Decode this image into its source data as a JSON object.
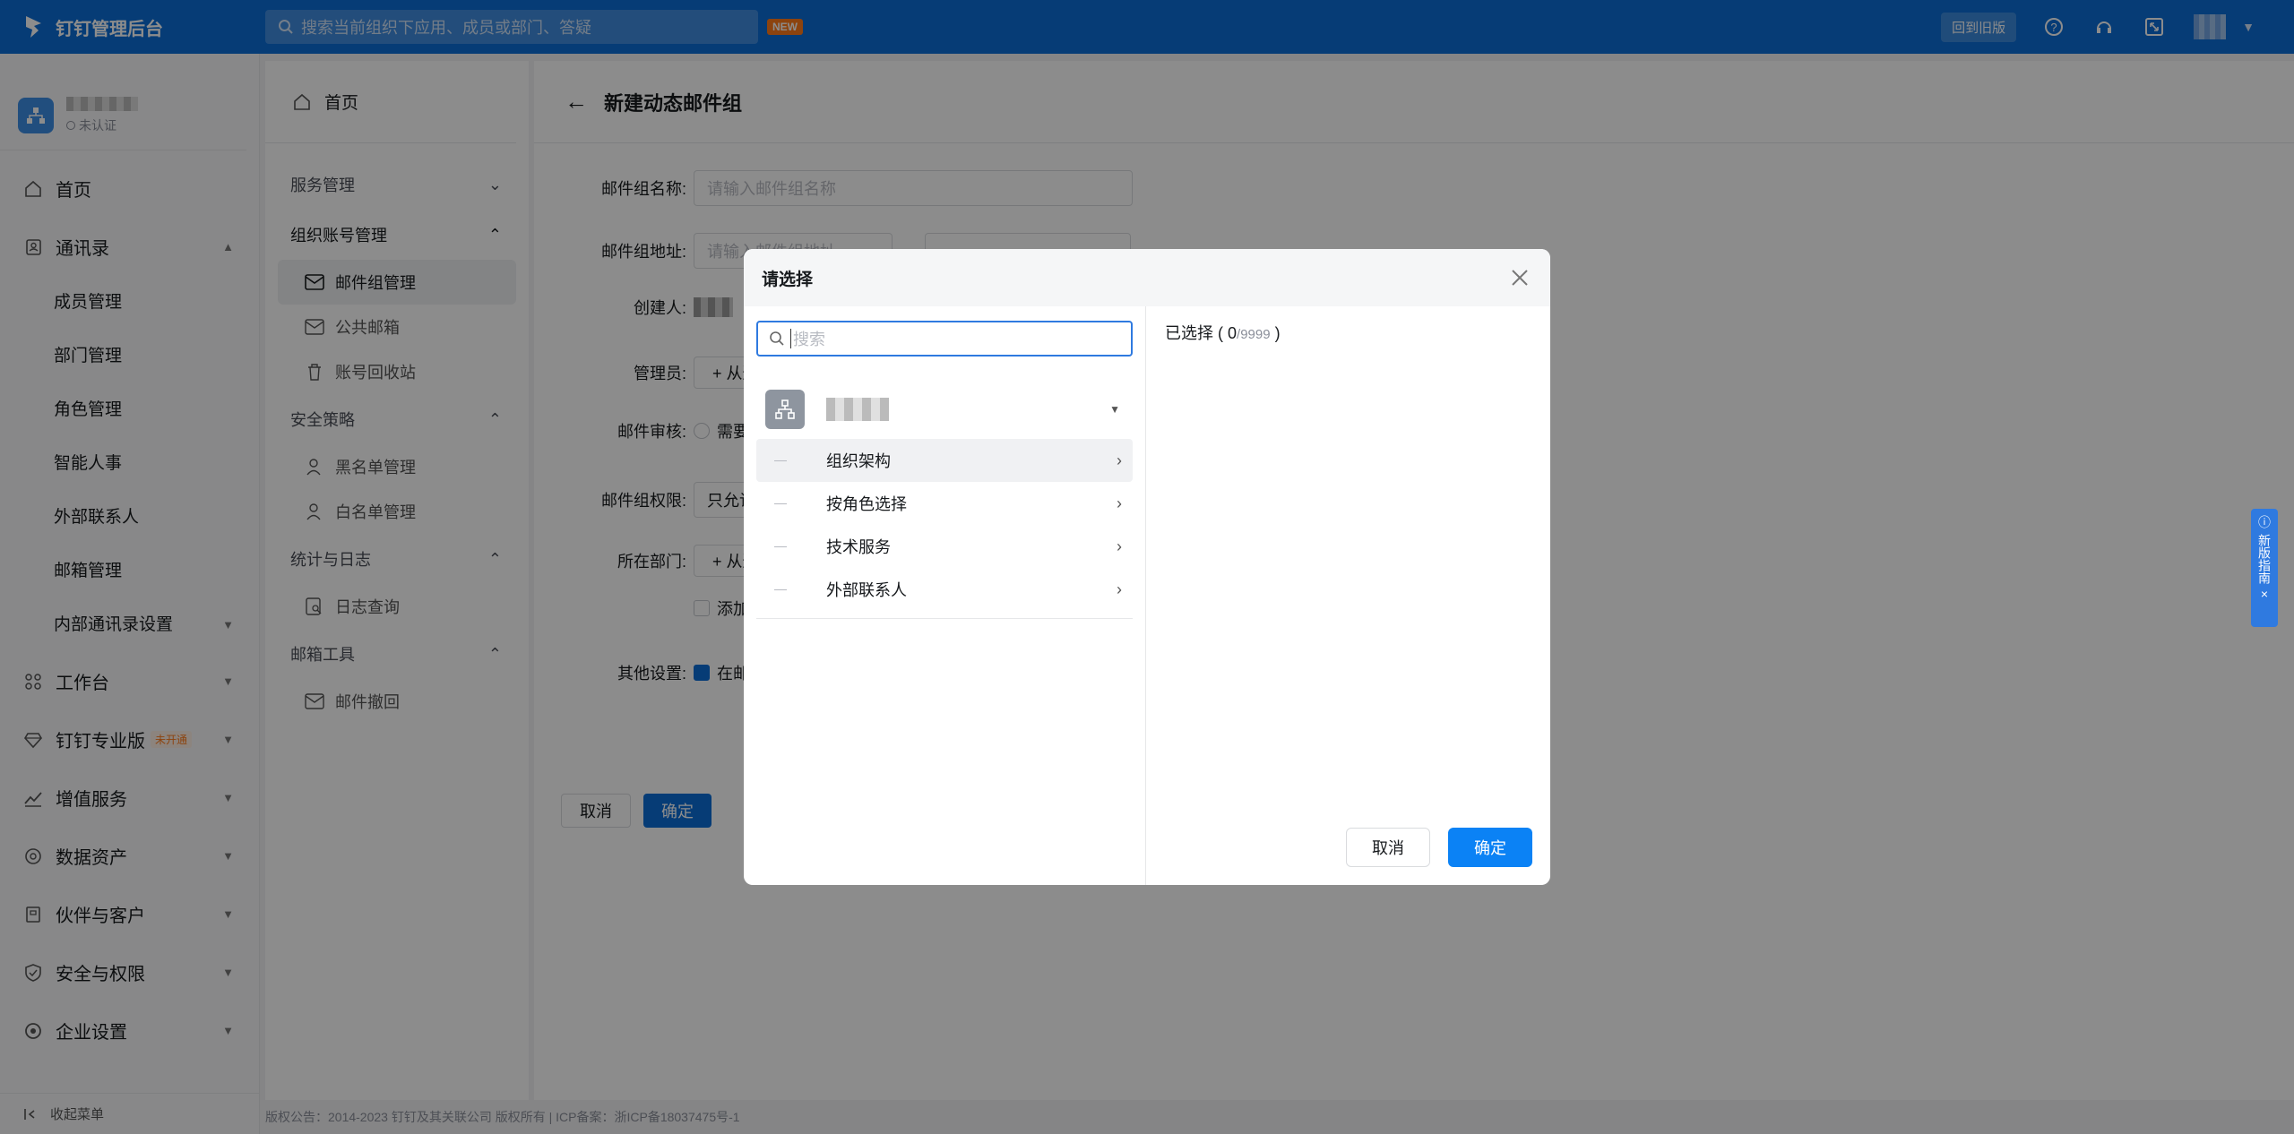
{
  "topbar": {
    "app_name": "钉钉管理后台",
    "search_placeholder": "搜索当前组织下应用、成员或部门、答疑",
    "new_badge": "NEW",
    "old_version": "回到旧版"
  },
  "org": {
    "status": "未认证"
  },
  "sidebar": {
    "home": "首页",
    "contacts": "通讯录",
    "contacts_items": [
      "成员管理",
      "部门管理",
      "角色管理",
      "智能人事",
      "外部联系人",
      "邮箱管理",
      "内部通讯录设置"
    ],
    "workbench": "工作台",
    "pro": "钉钉专业版",
    "pro_badge": "未开通",
    "value_added": "增值服务",
    "data_assets": "数据资产",
    "partners": "伙伴与客户",
    "security": "安全与权限",
    "enterprise": "企业设置",
    "collapse": "收起菜单"
  },
  "submenu": {
    "home": "首页",
    "service_mgmt": "服务管理",
    "org_account": "组织账号管理",
    "mail_group": "邮件组管理",
    "public_mail": "公共邮箱",
    "recycle": "账号回收站",
    "security_policy": "安全策略",
    "blacklist": "黑名单管理",
    "whitelist": "白名单管理",
    "stats_logs": "统计与日志",
    "log_query": "日志查询",
    "mail_tools": "邮箱工具",
    "mail_recall": "邮件撤回"
  },
  "main": {
    "title": "新建动态邮件组",
    "name_label": "邮件组名称:",
    "name_placeholder": "请输入邮件组名称",
    "addr_label": "邮件组地址:",
    "addr_placeholder": "请输入邮件组地址",
    "creator_label": "创建人:",
    "admin_label": "管理员:",
    "admin_btn": "+ 从通讯录添加",
    "audit_label": "邮件审核:",
    "audit_opt": "需要审核",
    "perm_label": "邮件组权限:",
    "perm_value": "只允许组内成员",
    "dept_label": "所在部门:",
    "dept_btn": "+ 从通讯录添加",
    "dept_add": "添加",
    "other_label": "其他设置:",
    "other_opt": "在邮件组内",
    "cancel": "取消",
    "confirm": "确定"
  },
  "footer": {
    "copyright": "版权公告：2014-2023 钉钉及其关联公司 版权所有 | ICP备案：浙ICP备18037475号-1"
  },
  "guide": {
    "text": "新版指南"
  },
  "modal": {
    "title": "请选择",
    "search_placeholder": "搜索",
    "list": [
      "组织架构",
      "按角色选择",
      "技术服务",
      "外部联系人"
    ],
    "selected_label": "已选择",
    "selected_count": "0",
    "selected_max": "/9999",
    "cancel": "取消",
    "confirm": "确定"
  }
}
